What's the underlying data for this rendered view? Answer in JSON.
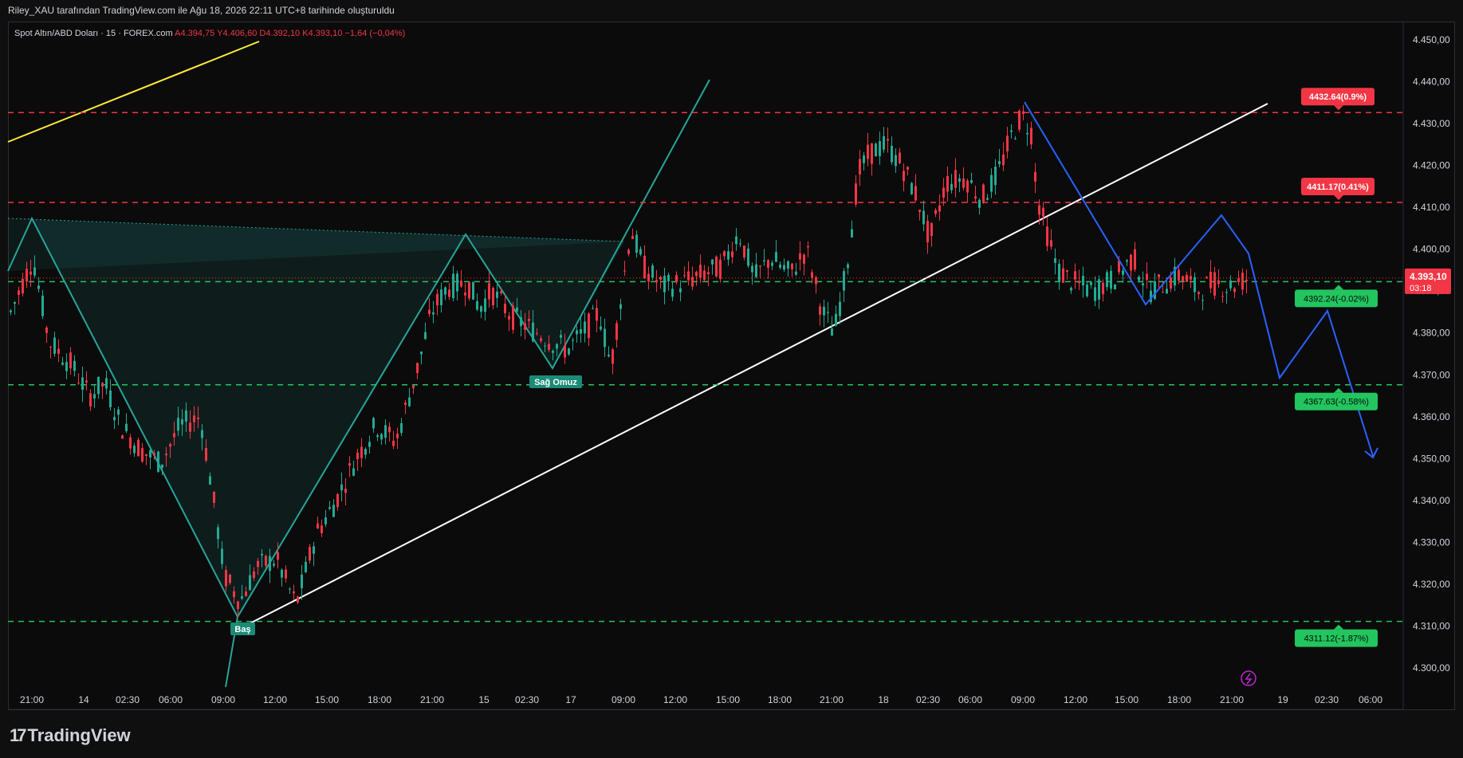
{
  "caption": "Riley_XAU tarafından TradingView.com ile Ağu 18, 2026 22:11 UTC+8 tarihinde oluşturuldu",
  "symbol": {
    "name": "Spot Altın/ABD Doları · 15 · FOREX.com",
    "o_label": "A",
    "o_val": "4.394,75",
    "h_label": "Y",
    "h_val": "4.406,60",
    "l_label": "D",
    "l_val": "4.392,10",
    "c_label": "K",
    "c_val": "4.393,10",
    "change": "−1,64 (−0,04%)"
  },
  "brand": "TradingView",
  "chart_data": {
    "type": "candlestick",
    "y_axis_labels": [
      "4.450,00",
      "4.440,00",
      "4.430,00",
      "4.420,00",
      "4.410,00",
      "4.400,00",
      "4.390,00",
      "4.380,00",
      "4.370,00",
      "4.360,00",
      "4.350,00",
      "4.340,00",
      "4.330,00",
      "4.320,00",
      "4.310,00",
      "4.300,00"
    ],
    "y_axis_values": [
      4450,
      4440,
      4430,
      4420,
      4410,
      4400,
      4390,
      4380,
      4370,
      4360,
      4350,
      4340,
      4330,
      4320,
      4310,
      4300
    ],
    "x_axis_labels": [
      "21:00",
      "14",
      "02:30",
      "06:00",
      "09:00",
      "12:00",
      "15:00",
      "18:00",
      "21:00",
      "15",
      "02:30",
      "17",
      "09:00",
      "12:00",
      "15:00",
      "18:00",
      "21:00",
      "18",
      "02:30",
      "06:00",
      "09:00",
      "12:00",
      "15:00",
      "18:00",
      "21:00",
      "19",
      "02:30",
      "06:00"
    ],
    "current_price": {
      "label": "4.393,10",
      "countdown": "03:18",
      "value": 4393.1
    },
    "levels": [
      {
        "label": "4432.64(0.9%)",
        "value": 4432.64,
        "color": "#f23645"
      },
      {
        "label": "4411.17(0.41%)",
        "value": 4411.17,
        "color": "#f23645"
      },
      {
        "label": "4392.24(-0.02%)",
        "value": 4392.24,
        "color": "#22c55e"
      },
      {
        "label": "4367.63(-0.58%)",
        "value": 4367.63,
        "color": "#22c55e"
      },
      {
        "label": "4311.12(-1.87%)",
        "value": 4311.12,
        "color": "#22c55e"
      }
    ],
    "annotations": [
      "Baş",
      "Sağ Omuz"
    ],
    "colors": {
      "up": "#22ab94",
      "down": "#f23645",
      "pattern": "#26a69a",
      "projection": "#2962ff",
      "trendline": "#ffffff",
      "yellow_line": "#ffeb3b"
    }
  }
}
